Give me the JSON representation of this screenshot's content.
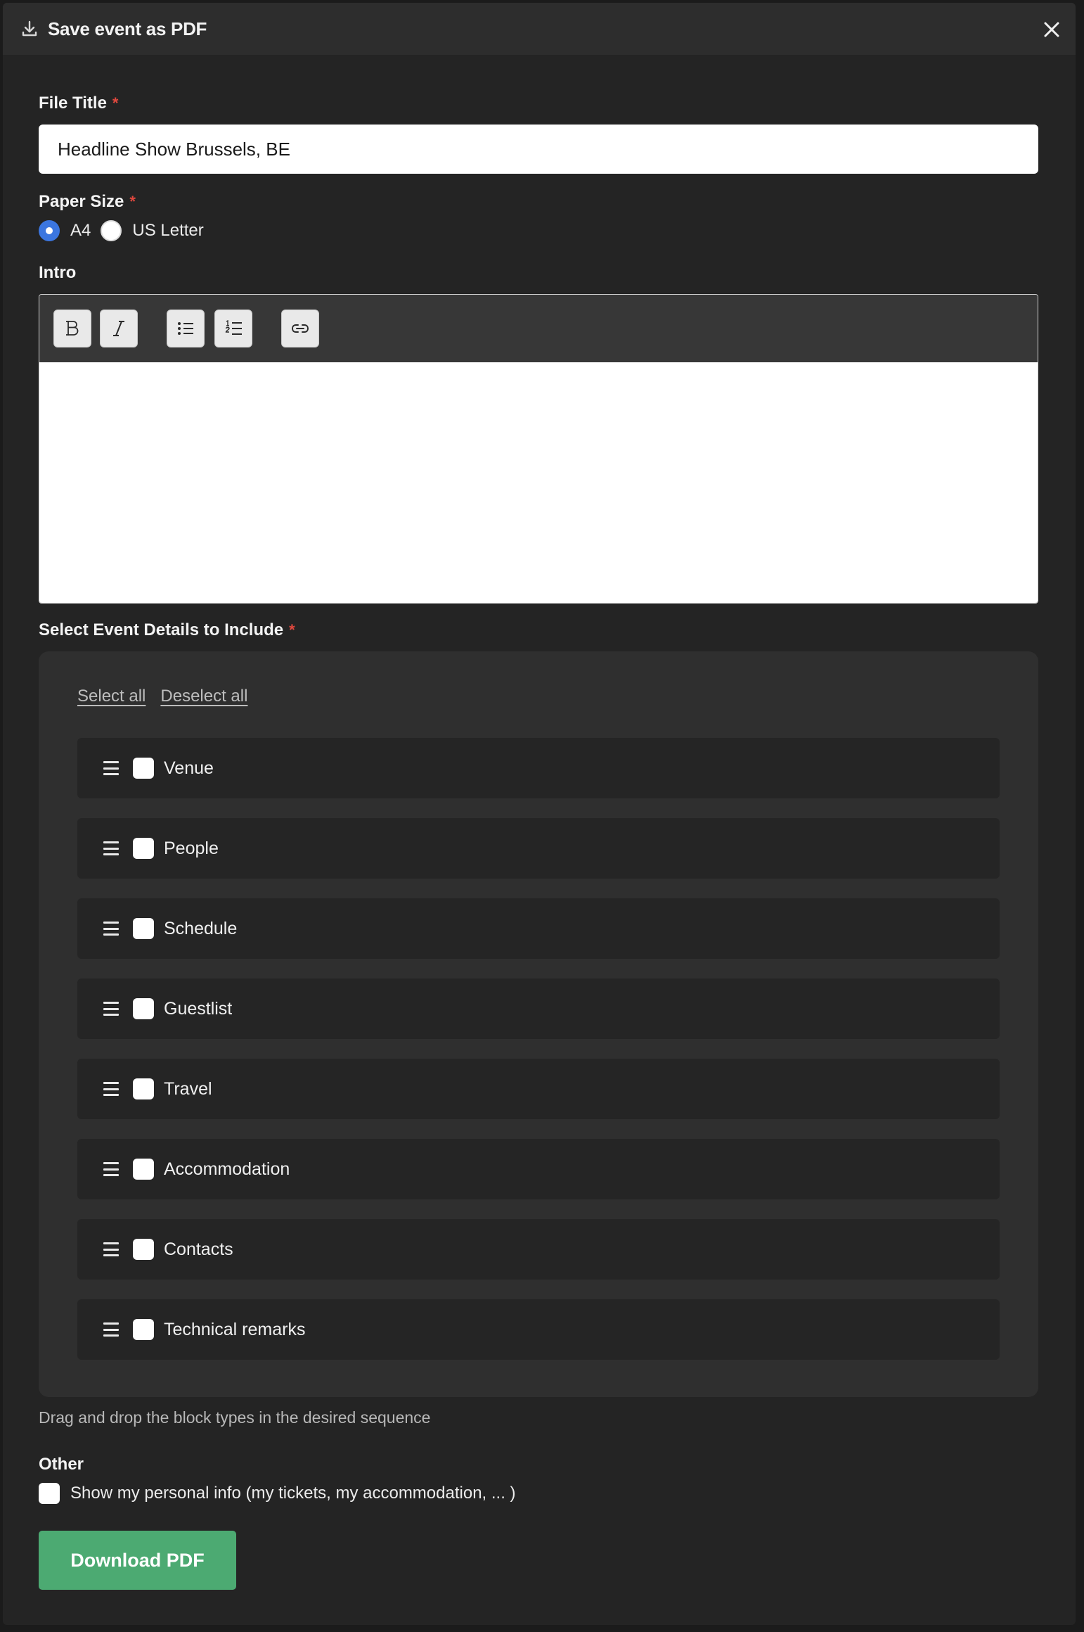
{
  "header": {
    "title": "Save event as PDF",
    "icon": "download-icon",
    "close_icon": "close-icon"
  },
  "form": {
    "file_title": {
      "label": "File Title",
      "required_mark": "*",
      "value": "Headline Show Brussels, BE"
    },
    "paper_size": {
      "label": "Paper Size",
      "required_mark": "*",
      "options": [
        {
          "label": "A4",
          "selected": true
        },
        {
          "label": "US Letter",
          "selected": false
        }
      ]
    },
    "intro": {
      "label": "Intro",
      "toolbar": [
        "bold-icon",
        "italic-icon",
        "bulleted-list-icon",
        "numbered-list-icon",
        "link-icon"
      ],
      "content": ""
    },
    "details": {
      "label": "Select Event Details to Include",
      "required_mark": "*",
      "select_all": "Select all",
      "deselect_all": "Deselect all",
      "items": [
        {
          "label": "Venue",
          "checked": false
        },
        {
          "label": "People",
          "checked": false
        },
        {
          "label": "Schedule",
          "checked": false
        },
        {
          "label": "Guestlist",
          "checked": false
        },
        {
          "label": "Travel",
          "checked": false
        },
        {
          "label": "Accommodation",
          "checked": false
        },
        {
          "label": "Contacts",
          "checked": false
        },
        {
          "label": "Technical remarks",
          "checked": false
        }
      ],
      "hint": "Drag and drop the block types in the desired sequence"
    },
    "other": {
      "label": "Other",
      "personal_info": {
        "label": "Show my personal info (my tickets, my accommodation, ... )",
        "checked": false
      }
    },
    "submit_label": "Download PDF"
  },
  "colors": {
    "accent_blue": "#3b76e0",
    "submit_green": "#4caa72",
    "required_red": "#e0483e",
    "modal_bg": "#242424"
  }
}
